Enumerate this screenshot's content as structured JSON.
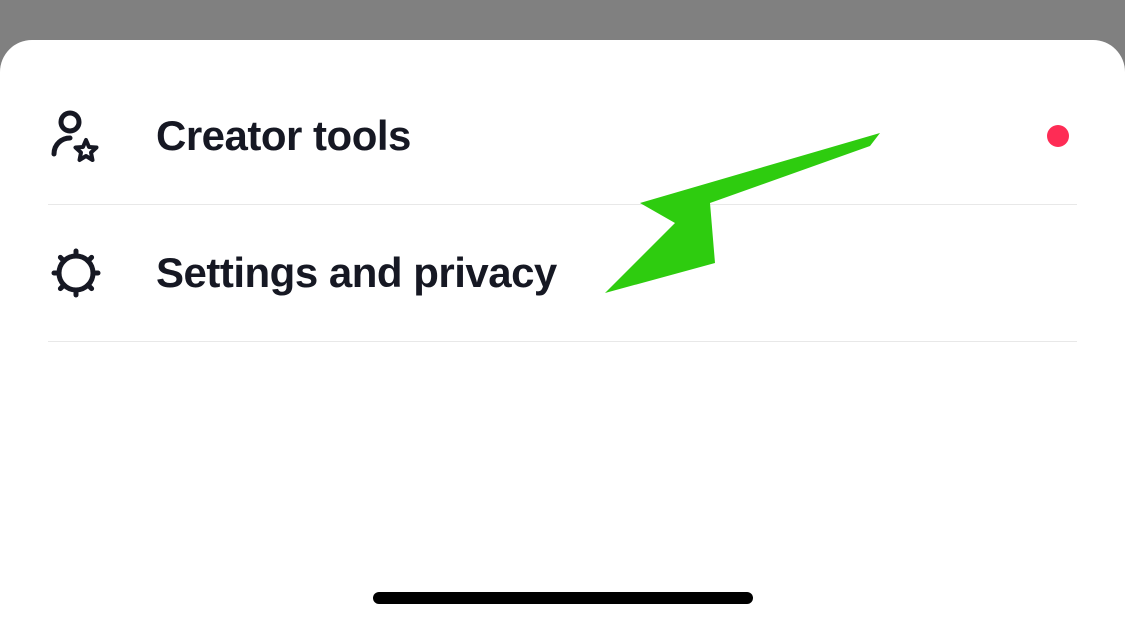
{
  "menu": {
    "items": [
      {
        "label": "Creator tools",
        "icon": "user-star-icon",
        "hasNotification": true
      },
      {
        "label": "Settings and privacy",
        "icon": "gear-icon",
        "hasNotification": false
      }
    ]
  },
  "annotation": {
    "color": "#2ecc0f"
  }
}
